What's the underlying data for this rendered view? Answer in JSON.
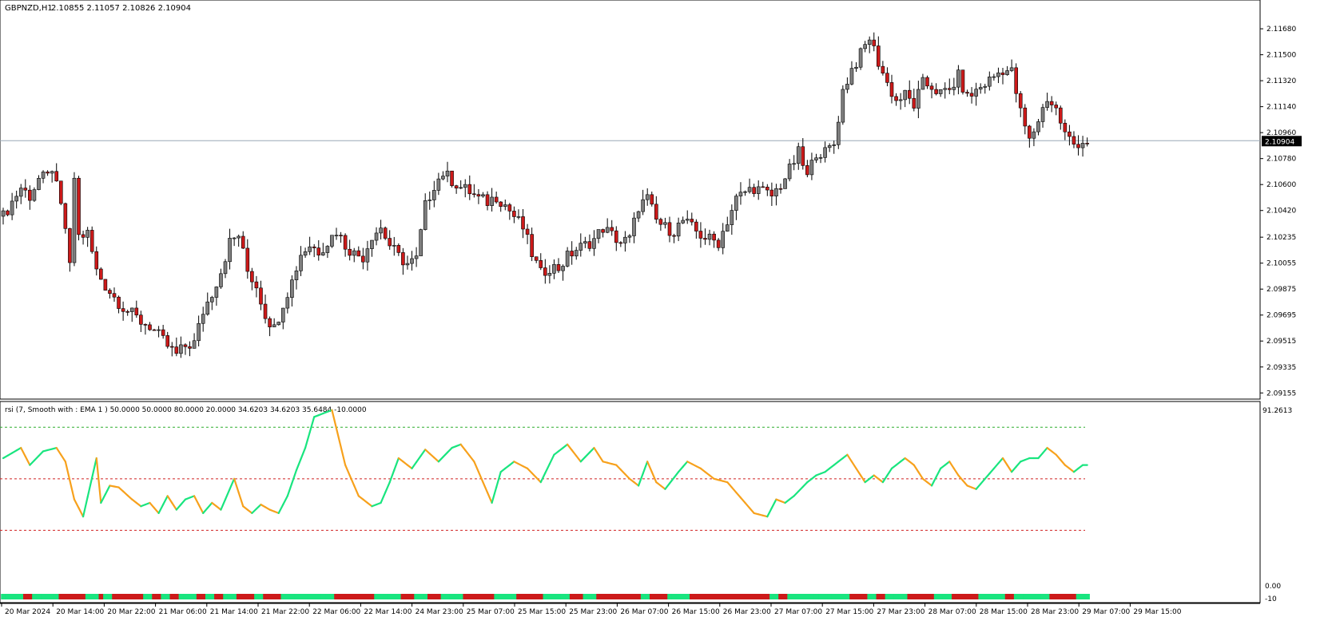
{
  "main_chart": {
    "symbol_label": "GBPNZD,H1",
    "ohlc_text": "2.10855 2.11057 2.10826 2.10904",
    "current_price_label": "2.10904",
    "y_tick_labels": [
      "2.11680",
      "2.11500",
      "2.11320",
      "2.11140",
      "2.10960",
      "2.10780",
      "2.10600",
      "2.10420",
      "2.10235",
      "2.10055",
      "2.09875",
      "2.09695",
      "2.09515",
      "2.09335",
      "2.09155"
    ]
  },
  "indicator": {
    "label": "rsi (7, Smooth with : EMA  1 ) 50.0000 50.0000 80.0000 20.0000 34.6203 34.6203 35.6484 -10.0000",
    "y_tick_labels": [
      "91.2613",
      "0.00",
      "-10"
    ]
  },
  "x_axis_labels": [
    "20 Mar 2024",
    "20 Mar 14:00",
    "20 Mar 22:00",
    "21 Mar 06:00",
    "21 Mar 14:00",
    "21 Mar 22:00",
    "22 Mar 06:00",
    "22 Mar 14:00",
    "24 Mar 23:00",
    "25 Mar 07:00",
    "25 Mar 15:00",
    "25 Mar 23:00",
    "26 Mar 07:00",
    "26 Mar 15:00",
    "26 Mar 23:00",
    "27 Mar 07:00",
    "27 Mar 15:00",
    "27 Mar 23:00",
    "28 Mar 07:00",
    "28 Mar 15:00",
    "28 Mar 23:00",
    "29 Mar 07:00",
    "29 Mar 15:00"
  ],
  "colors": {
    "bull_candle": "#7f7f7f",
    "bear_candle": "#cc1a1a",
    "wick": "#000000",
    "rsi_up": "#19e57f",
    "rsi_down": "#f7a11c",
    "level_upper": "#2fae2f",
    "level_mid": "#d02020",
    "level_lower": "#d02020",
    "price_line": "#9aa8b6"
  },
  "chart_data": [
    {
      "type": "candlestick",
      "title": "GBPNZD,H1",
      "ylim": [
        2.0914,
        2.1178
      ],
      "current_price": 2.10904,
      "x": [
        "20 Mar 2024",
        "20 Mar 14:00",
        "20 Mar 22:00",
        "21 Mar 06:00",
        "21 Mar 14:00",
        "21 Mar 22:00",
        "22 Mar 06:00",
        "22 Mar 14:00",
        "24 Mar 23:00",
        "25 Mar 07:00",
        "25 Mar 15:00",
        "25 Mar 23:00",
        "26 Mar 07:00",
        "26 Mar 15:00",
        "26 Mar 23:00",
        "27 Mar 07:00",
        "27 Mar 15:00",
        "27 Mar 23:00",
        "28 Mar 07:00",
        "28 Mar 15:00",
        "28 Mar 23:00",
        "29 Mar 07:00",
        "29 Mar 15:00"
      ],
      "anchors": [
        [
          0,
          2.1038
        ],
        [
          2,
          2.1048
        ],
        [
          4,
          2.1058
        ],
        [
          6,
          2.1052
        ],
        [
          8,
          2.1064
        ],
        [
          10,
          2.1065
        ],
        [
          11,
          2.1072
        ],
        [
          12,
          2.1058
        ],
        [
          14,
          2.103
        ],
        [
          15,
          2.1002
        ],
        [
          16,
          2.1065
        ],
        [
          17,
          2.1024
        ],
        [
          19,
          2.1026
        ],
        [
          21,
          2.1
        ],
        [
          23,
          2.099
        ],
        [
          25,
          2.0982
        ],
        [
          27,
          2.0975
        ],
        [
          29,
          2.097
        ],
        [
          31,
          2.0965
        ],
        [
          33,
          2.0962
        ],
        [
          35,
          2.0955
        ],
        [
          37,
          2.0948
        ],
        [
          39,
          2.0942
        ],
        [
          41,
          2.0948
        ],
        [
          43,
          2.095
        ],
        [
          45,
          2.0972
        ],
        [
          47,
          2.0985
        ],
        [
          49,
          2.1
        ],
        [
          51,
          2.102
        ],
        [
          53,
          2.1025
        ],
        [
          55,
          2.1
        ],
        [
          57,
          2.099
        ],
        [
          59,
          2.097
        ],
        [
          61,
          2.096
        ],
        [
          63,
          2.0978
        ],
        [
          65,
          2.0993
        ],
        [
          67,
          2.1012
        ],
        [
          69,
          2.1018
        ],
        [
          71,
          2.1014
        ],
        [
          73,
          2.102
        ],
        [
          75,
          2.1028
        ],
        [
          77,
          2.1018
        ],
        [
          79,
          2.1012
        ],
        [
          81,
          2.101
        ],
        [
          83,
          2.1025
        ],
        [
          85,
          2.103
        ],
        [
          87,
          2.1018
        ],
        [
          89,
          2.101
        ],
        [
          91,
          2.1005
        ],
        [
          93,
          2.1008
        ],
        [
          95,
          2.1045
        ],
        [
          97,
          2.106
        ],
        [
          99,
          2.1068
        ],
        [
          101,
          2.1063
        ],
        [
          103,
          2.1058
        ],
        [
          105,
          2.1055
        ],
        [
          107,
          2.105
        ],
        [
          109,
          2.1048
        ],
        [
          111,
          2.1052
        ],
        [
          113,
          2.1046
        ],
        [
          115,
          2.1038
        ],
        [
          117,
          2.103
        ],
        [
          119,
          2.1012
        ],
        [
          121,
          2.0998
        ],
        [
          123,
          2.1003
        ],
        [
          125,
          2.1002
        ],
        [
          127,
          2.101
        ],
        [
          129,
          2.1015
        ],
        [
          131,
          2.1018
        ],
        [
          133,
          2.1022
        ],
        [
          135,
          2.103
        ],
        [
          137,
          2.1025
        ],
        [
          139,
          2.102
        ],
        [
          141,
          2.1022
        ],
        [
          143,
          2.1045
        ],
        [
          145,
          2.105
        ],
        [
          147,
          2.1035
        ],
        [
          149,
          2.103
        ],
        [
          151,
          2.1028
        ],
        [
          153,
          2.1035
        ],
        [
          155,
          2.103
        ],
        [
          157,
          2.1025
        ],
        [
          159,
          2.1022
        ],
        [
          161,
          2.102
        ],
        [
          163,
          2.1035
        ],
        [
          165,
          2.105
        ],
        [
          167,
          2.1055
        ],
        [
          169,
          2.1058
        ],
        [
          171,
          2.1055
        ],
        [
          173,
          2.1052
        ],
        [
          175,
          2.106
        ],
        [
          177,
          2.107
        ],
        [
          179,
          2.1082
        ],
        [
          181,
          2.1065
        ],
        [
          183,
          2.1083
        ],
        [
          185,
          2.1082
        ],
        [
          187,
          2.1088
        ],
        [
          189,
          2.1125
        ],
        [
          191,
          2.114
        ],
        [
          193,
          2.115
        ],
        [
          195,
          2.1162
        ],
        [
          197,
          2.1145
        ],
        [
          199,
          2.113
        ],
        [
          201,
          2.1118
        ],
        [
          203,
          2.1122
        ],
        [
          205,
          2.1115
        ],
        [
          207,
          2.113
        ],
        [
          209,
          2.1128
        ],
        [
          211,
          2.1123
        ],
        [
          213,
          2.1125
        ],
        [
          215,
          2.1135
        ],
        [
          217,
          2.112
        ],
        [
          219,
          2.1125
        ],
        [
          221,
          2.113
        ],
        [
          223,
          2.1135
        ],
        [
          225,
          2.114
        ],
        [
          227,
          2.1138
        ],
        [
          229,
          2.111
        ],
        [
          231,
          2.109
        ],
        [
          233,
          2.1105
        ],
        [
          235,
          2.112
        ],
        [
          237,
          2.1112
        ],
        [
          239,
          2.1095
        ],
        [
          241,
          2.1088
        ],
        [
          243,
          2.109
        ]
      ]
    },
    {
      "type": "line",
      "title": "rsi (7, Smooth with : EMA  1 )",
      "ylim": [
        -10,
        91.2613
      ],
      "levels": [
        80,
        50,
        20
      ],
      "series": [
        {
          "name": "rsi",
          "anchors": [
            [
              0,
              62
            ],
            [
              4,
              68
            ],
            [
              6,
              58
            ],
            [
              9,
              66
            ],
            [
              12,
              68
            ],
            [
              14,
              60
            ],
            [
              16,
              38
            ],
            [
              18,
              28
            ],
            [
              21,
              62
            ],
            [
              22,
              36
            ],
            [
              24,
              46
            ],
            [
              26,
              45
            ],
            [
              29,
              38
            ],
            [
              31,
              34
            ],
            [
              33,
              36
            ],
            [
              35,
              30
            ],
            [
              37,
              40
            ],
            [
              39,
              32
            ],
            [
              41,
              38
            ],
            [
              43,
              40
            ],
            [
              45,
              30
            ],
            [
              47,
              36
            ],
            [
              49,
              32
            ],
            [
              52,
              50
            ],
            [
              54,
              34
            ],
            [
              56,
              30
            ],
            [
              58,
              35
            ],
            [
              60,
              32
            ],
            [
              62,
              30
            ],
            [
              64,
              40
            ],
            [
              66,
              55
            ],
            [
              68,
              68
            ],
            [
              70,
              86
            ],
            [
              74,
              90
            ],
            [
              77,
              58
            ],
            [
              80,
              40
            ],
            [
              83,
              34
            ],
            [
              85,
              36
            ],
            [
              87,
              48
            ],
            [
              89,
              62
            ],
            [
              92,
              56
            ],
            [
              95,
              67
            ],
            [
              98,
              60
            ],
            [
              101,
              68
            ],
            [
              103,
              70
            ],
            [
              106,
              60
            ],
            [
              108,
              48
            ],
            [
              110,
              36
            ],
            [
              112,
              54
            ],
            [
              115,
              60
            ],
            [
              118,
              56
            ],
            [
              121,
              48
            ],
            [
              124,
              64
            ],
            [
              127,
              70
            ],
            [
              130,
              60
            ],
            [
              133,
              68
            ],
            [
              135,
              60
            ],
            [
              138,
              58
            ],
            [
              141,
              50
            ],
            [
              143,
              46
            ],
            [
              145,
              60
            ],
            [
              147,
              48
            ],
            [
              149,
              44
            ],
            [
              152,
              54
            ],
            [
              154,
              60
            ],
            [
              157,
              56
            ],
            [
              160,
              50
            ],
            [
              163,
              48
            ],
            [
              165,
              42
            ],
            [
              167,
              36
            ],
            [
              169,
              30
            ],
            [
              172,
              28
            ],
            [
              174,
              38
            ],
            [
              176,
              36
            ],
            [
              178,
              40
            ],
            [
              181,
              48
            ],
            [
              183,
              52
            ],
            [
              185,
              54
            ],
            [
              187,
              58
            ],
            [
              190,
              64
            ],
            [
              192,
              56
            ],
            [
              194,
              48
            ],
            [
              196,
              52
            ],
            [
              198,
              48
            ],
            [
              200,
              56
            ],
            [
              203,
              62
            ],
            [
              205,
              58
            ],
            [
              207,
              50
            ],
            [
              209,
              46
            ],
            [
              211,
              56
            ],
            [
              213,
              60
            ],
            [
              215,
              52
            ],
            [
              217,
              46
            ],
            [
              219,
              44
            ],
            [
              221,
              50
            ],
            [
              223,
              56
            ],
            [
              225,
              62
            ],
            [
              227,
              54
            ],
            [
              229,
              60
            ],
            [
              231,
              62
            ],
            [
              233,
              62
            ],
            [
              235,
              68
            ],
            [
              237,
              64
            ],
            [
              239,
              58
            ],
            [
              241,
              54
            ],
            [
              243,
              58
            ]
          ]
        }
      ]
    }
  ]
}
